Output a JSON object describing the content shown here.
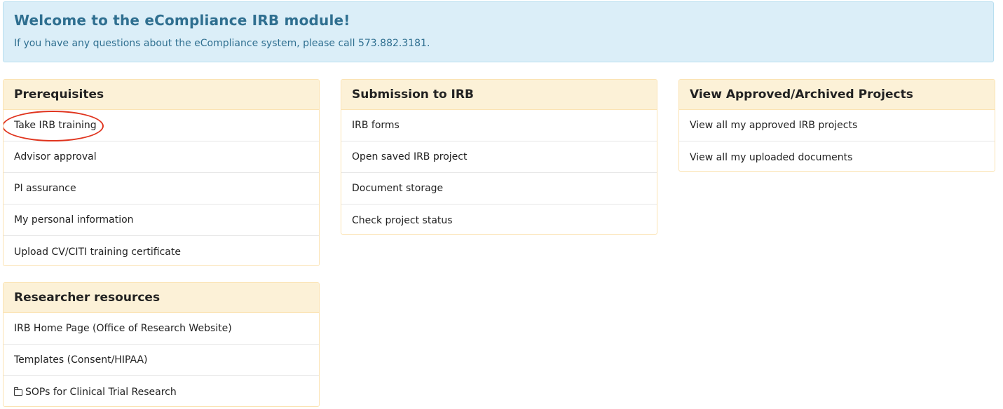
{
  "welcome": {
    "title": "Welcome to the eCompliance IRB module!",
    "text": "If you have any questions about the eCompliance system, please call 573.882.3181."
  },
  "prerequisites": {
    "heading": "Prerequisites",
    "items": [
      "Take IRB training",
      "Advisor approval",
      "PI assurance",
      "My personal information",
      "Upload CV/CITI training certificate"
    ]
  },
  "submission": {
    "heading": "Submission to IRB",
    "items": [
      "IRB forms",
      "Open saved IRB project",
      "Document storage",
      "Check project status"
    ]
  },
  "approved": {
    "heading": "View Approved/Archived Projects",
    "items": [
      "View all my approved IRB projects",
      "View all my uploaded documents"
    ]
  },
  "resources": {
    "heading": "Researcher resources",
    "items": [
      "IRB Home Page (Office of Research Website)",
      "Templates (Consent/HIPAA)",
      "SOPs for Clinical Trial Research"
    ],
    "folder_icon": "folder-icon"
  },
  "colors": {
    "welcome_bg": "#dbeef8",
    "welcome_text": "#2f6f90",
    "panel_heading_bg": "#fcf1d7",
    "panel_border": "#fbe3b3",
    "highlight_ring": "#e0351f"
  }
}
